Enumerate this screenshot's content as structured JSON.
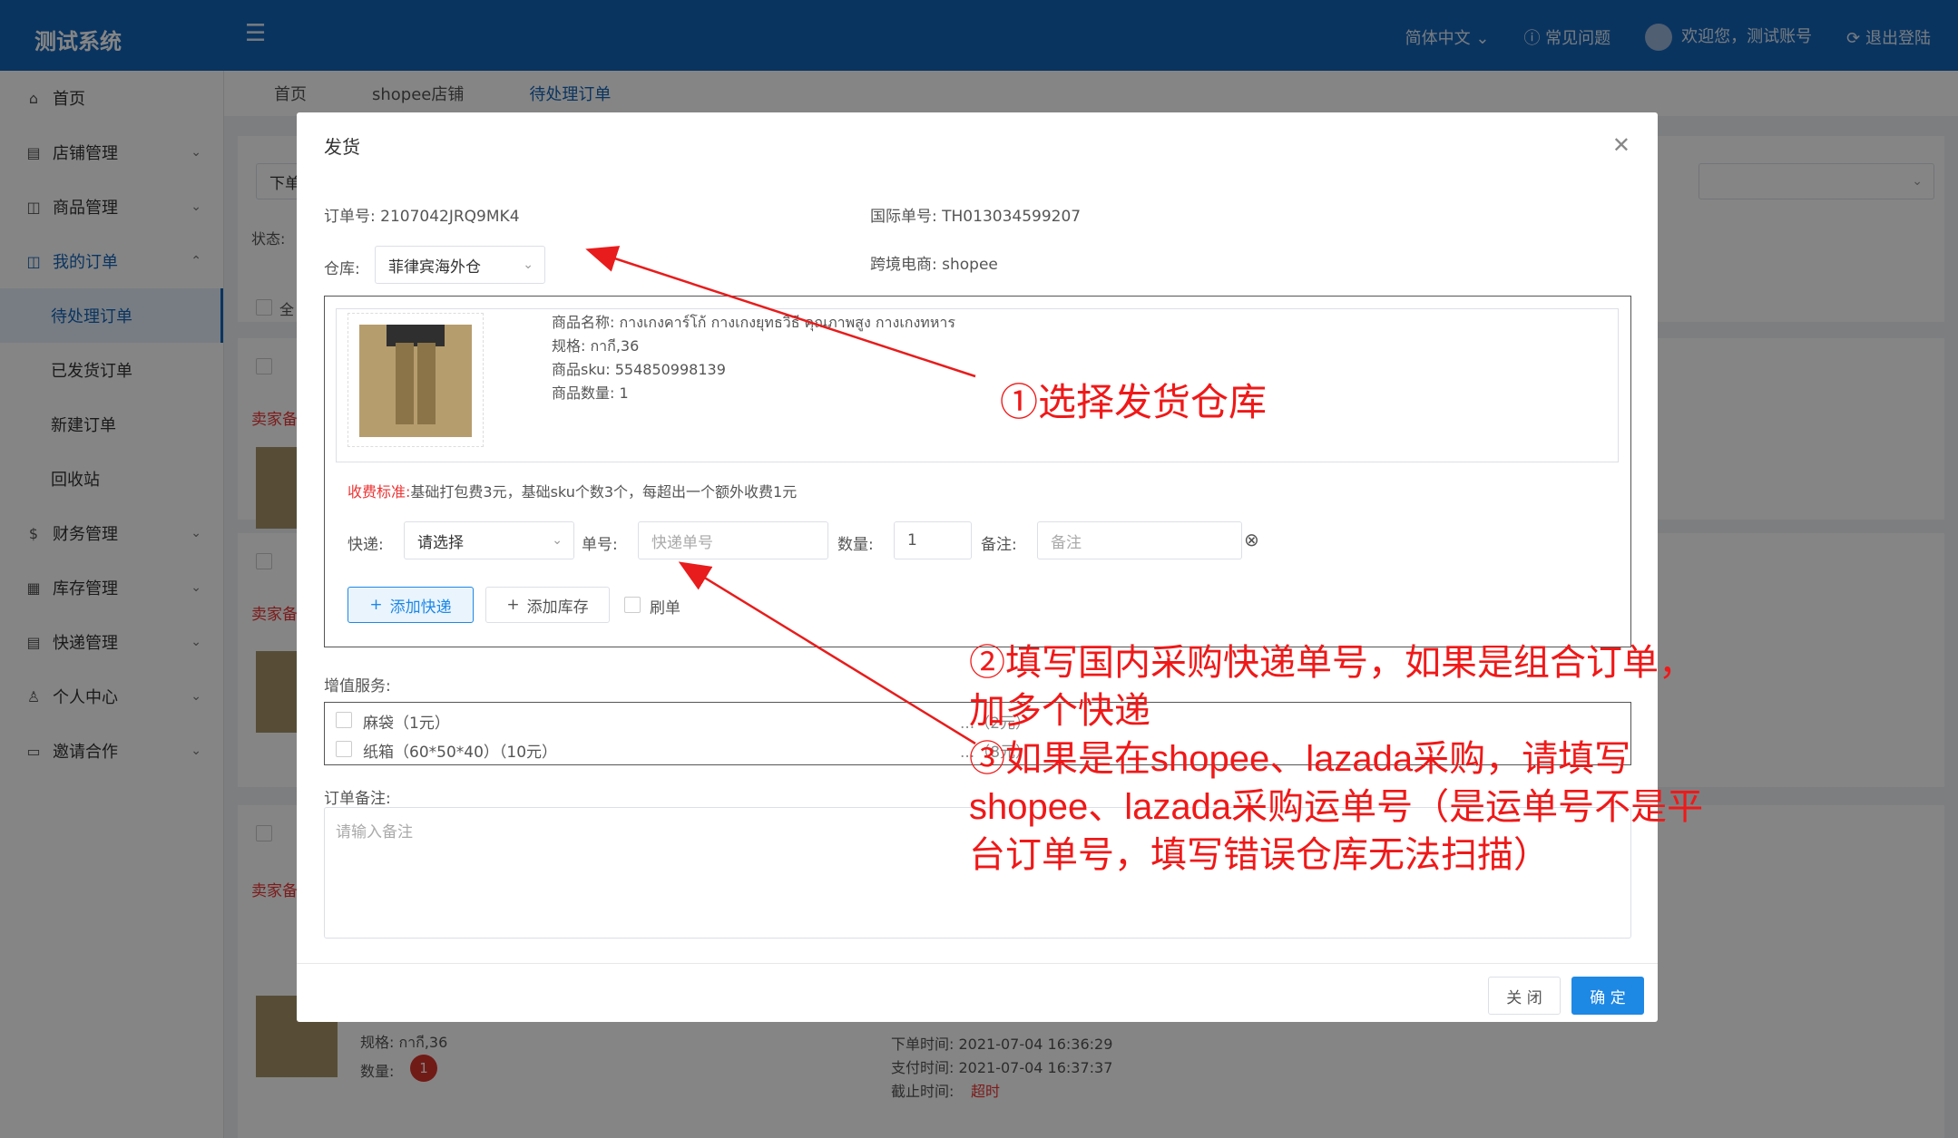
{
  "app": {
    "logo": "测试系统",
    "language": "简体中文",
    "faq": "常见问题",
    "welcome": "欢迎您，测试账号",
    "logout": "退出登陆"
  },
  "sidebar": {
    "items": [
      {
        "label": "首页",
        "icon": "home-icon"
      },
      {
        "label": "店铺管理",
        "icon": "store-icon"
      },
      {
        "label": "商品管理",
        "icon": "bag-icon"
      },
      {
        "label": "我的订单",
        "icon": "order-icon"
      },
      {
        "label": "待处理订单"
      },
      {
        "label": "已发货订单"
      },
      {
        "label": "新建订单"
      },
      {
        "label": "回收站"
      },
      {
        "label": "财务管理",
        "icon": "finance-icon"
      },
      {
        "label": "库存管理",
        "icon": "grid-icon"
      },
      {
        "label": "快递管理",
        "icon": "list-icon"
      },
      {
        "label": "个人中心",
        "icon": "user-icon"
      },
      {
        "label": "邀请合作",
        "icon": "invite-icon"
      }
    ]
  },
  "tabs": [
    "首页",
    "shopee店铺",
    "待处理订单"
  ],
  "background": {
    "filter_prefix": "下单",
    "status_label": "状态:",
    "select_all": "全",
    "seller_note": "卖家备",
    "spec": "规格: กากี,36",
    "qty_label": "数量:",
    "qty_badge": "1",
    "order_time": "下单时间:  2021-07-04 16:36:29",
    "pay_time": "支付时间:  2021-07-04 16:37:37",
    "deadline_label": "截止时间:",
    "deadline_value": "超时"
  },
  "modal": {
    "title": "发货",
    "order_no_label": "订单号:",
    "order_no": "2107042JRQ9MK4",
    "intl_no_label": "国际单号:",
    "intl_no": "TH013034599207",
    "warehouse_label": "仓库:",
    "warehouse_value": "菲律宾海外仓",
    "platform_label": "跨境电商:",
    "platform_value": "shopee",
    "product": {
      "name": "商品名称:  กางเกงคาร์โก้ กางเกงยุทธวิธี คุณภาพสูง กางเกงทหาร",
      "spec": "规格:  กากี,36",
      "sku": "商品sku:  554850998139",
      "qty": "商品数量:  1"
    },
    "fee_label": "收费标准:",
    "fee_text": "基础打包费3元，基础sku个数3个，每超出一个额外收费1元",
    "express_label": "快递:",
    "express_placeholder": "请选择",
    "tracking_label": "单号:",
    "tracking_placeholder": "快递单号",
    "qty_label": "数量:",
    "qty_value": "1",
    "remark_label": "备注:",
    "remark_placeholder": "备注",
    "add_express": "添加快递",
    "add_stock": "添加库存",
    "brush_order": "刷单",
    "value_added_label": "增值服务:",
    "services": [
      "麻袋（1元）",
      "纸箱（60*50*40）（10元）"
    ],
    "services_hidden": [
      "...（2元）",
      "...（8元）"
    ],
    "order_remark_label": "订单备注:",
    "order_remark_placeholder": "请输入备注",
    "close": "关 闭",
    "confirm": "确 定"
  },
  "annotations": {
    "a1": "①选择发货仓库",
    "a2_line1": "②填写国内采购快递单号，如果是组合订单，",
    "a2_line2": "加多个快递",
    "a3_line1": "③如果是在shopee、lazada采购，请填写",
    "a3_line2": "shopee、lazada采购运单号（是运单号不是平",
    "a3_line3": "台订单号，填写错误仓库无法扫描）"
  },
  "colors": {
    "header": "#1565b8",
    "primary": "#1e88e5",
    "annotation": "#f01818"
  }
}
